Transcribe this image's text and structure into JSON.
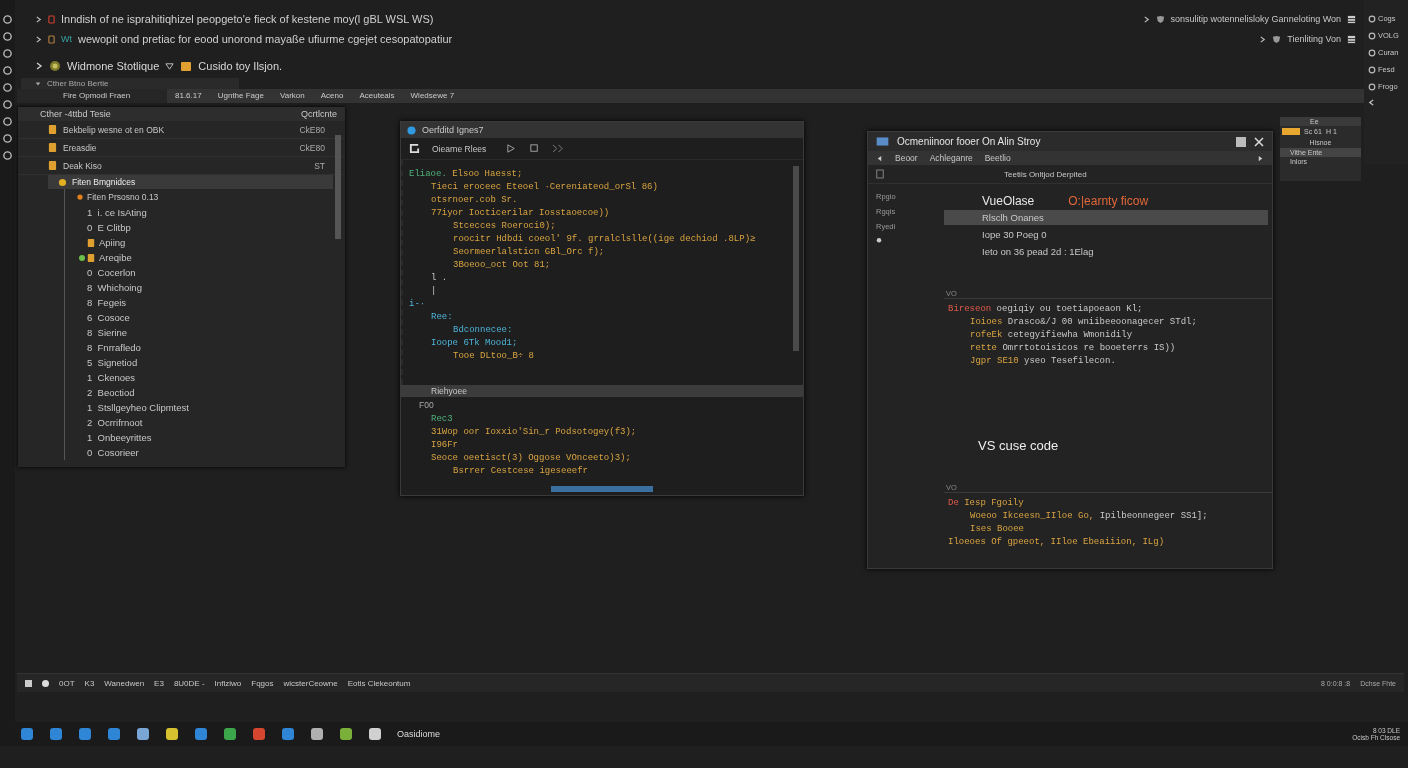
{
  "top_lines": [
    {
      "text": "Inndish of ne isprahitiqhizel peopgeto'e fieck of kestene moy(l gBL WSL WS)",
      "right": "sonsulitip wotennelisloky Ganneloting Won"
    },
    {
      "text": "wewopit ond pretiac for eood unorond mayaße ufiurme cgejet cesopatopatiur",
      "tag": "Wt",
      "right": "Tienliting Von"
    }
  ],
  "breadcrumb": [
    "Widmone Stotlique",
    "Cusido toy Ilsjon."
  ],
  "panel_header": "Cther Btno Bertie",
  "tabs": [
    {
      "label": "Fire Opmodi Fraen",
      "selected": true
    },
    {
      "label": "81.6.17",
      "selected": false
    },
    {
      "label": "Ugnthe Fage",
      "selected": false
    },
    {
      "label": "Varkon",
      "selected": false
    },
    {
      "label": "Aceno",
      "selected": false
    },
    {
      "label": "Aceuteals",
      "selected": false
    },
    {
      "label": "Wiedsewe 7",
      "selected": false
    }
  ],
  "explorer": {
    "title": "Cther -4ttbd Tesie",
    "action": "Qcrtlcnte",
    "rows": [
      {
        "name": "Bekbelip wesne ot en OBK",
        "meta": "CkE80"
      },
      {
        "name": "Ereasdie",
        "meta": "CkE80"
      },
      {
        "name": "Deak Kiso",
        "meta": "ST"
      }
    ],
    "selected_item": "Fiten Bmgnidces",
    "group": "Fiten Prsosno 0.13",
    "items": [
      {
        "kind": "count",
        "count": "1",
        "label": "i. ce IsAting"
      },
      {
        "kind": "count",
        "count": "0",
        "label": "E Clitbp"
      },
      {
        "kind": "file",
        "label": "Apiing"
      },
      {
        "kind": "file",
        "label": "Areqibe",
        "color": "#6cc04a"
      },
      {
        "kind": "count",
        "count": "0",
        "label": "Cocerlon"
      },
      {
        "kind": "count",
        "count": "8",
        "label": "Whichoing"
      },
      {
        "kind": "count",
        "count": "8",
        "label": "Fegeis"
      },
      {
        "kind": "count",
        "count": "6",
        "label": "Cosoce"
      },
      {
        "kind": "count",
        "count": "8",
        "label": "Sierine"
      },
      {
        "kind": "count",
        "count": "8",
        "label": "Fnrrafledo"
      },
      {
        "kind": "count",
        "count": "5",
        "label": "Signetiod"
      },
      {
        "kind": "count",
        "count": "1",
        "label": "Ckenoes"
      },
      {
        "kind": "count",
        "count": "2",
        "label": "Beoctiod"
      },
      {
        "kind": "count",
        "count": "1",
        "label": "Stsllgeyheo Clipmtest"
      },
      {
        "kind": "count",
        "count": "2",
        "label": "Ocrrifrnoot"
      },
      {
        "kind": "count",
        "count": "1",
        "label": "Onbeeyrittes"
      },
      {
        "kind": "count",
        "count": "0",
        "label": "Cosorieer"
      }
    ]
  },
  "editor": {
    "title": "Oerfditd Ignes7",
    "toolbar_label": "Oiearne Rlees",
    "lines": [
      {
        "parts": [
          {
            "kind": "keyword",
            "text": "Eliaoe."
          },
          {
            "kind": "string",
            "text": " Elsoo Haesst;"
          }
        ],
        "children": [
          {
            "parts": [
              {
                "kind": "string",
                "text": "Tieci eroceec Eteoel ·Cereniateod_orSl 86)"
              }
            ]
          },
          {
            "parts": [
              {
                "kind": "string",
                "text": "otsrnoer.cob Sr."
              }
            ]
          },
          {
            "parts": [
              {
                "kind": "string",
                "text": "77iyor Iocticerilar Iosstaoecoe))"
              }
            ],
            "children": [
              {
                "parts": [
                  {
                    "kind": "string",
                    "text": "Stcecces Roeroci0);"
                  }
                ]
              },
              {
                "parts": [
                  {
                    "kind": "string",
                    "text": "roocitr Hdbdi coeol' 9f. grralclslle((ige dechiod .8LP)≥"
                  }
                ]
              },
              {
                "parts": [
                  {
                    "kind": "string",
                    "text": "Seormeerlalsticn GBl_Orc f);"
                  }
                ]
              },
              {
                "parts": [
                  {
                    "kind": "string",
                    "text": "3Boeoo_oct Oot 81;"
                  }
                ]
              }
            ]
          },
          {
            "parts": [
              {
                "kind": "plain",
                "text": "l ."
              }
            ]
          },
          {
            "parts": [
              {
                "kind": "plain",
                "text": "|"
              }
            ]
          }
        ]
      },
      {
        "parts": [
          {
            "kind": "type",
            "text": "i-·"
          }
        ],
        "children": [
          {
            "parts": [
              {
                "kind": "type",
                "text": "Ree:"
              }
            ],
            "children": [
              {
                "parts": [
                  {
                    "kind": "type",
                    "text": "Bdconnecee:"
                  }
                ]
              }
            ]
          },
          {
            "parts": [
              {
                "kind": "type",
                "text": "Ioope 6Tk Mood1;"
              }
            ],
            "children": [
              {
                "parts": [
                  {
                    "kind": "string",
                    "text": "Tooe DLtoo_B÷ 8"
                  }
                ]
              }
            ]
          }
        ]
      }
    ],
    "panel_label": "Riehyoee",
    "panel_header": "F00",
    "panel_lines": [
      {
        "parts": [
          {
            "kind": "keyword",
            "text": "Rec3"
          }
        ]
      },
      {
        "parts": [
          {
            "kind": "string",
            "text": "31Wop oor Ioxxio'Sin_r Podsotogey(f3);"
          }
        ]
      },
      {
        "parts": [
          {
            "kind": "string",
            "text": "I96Fr"
          }
        ]
      },
      {
        "parts": [
          {
            "kind": "string",
            "text": "Seoce oeetisct(3) Oggose VOnceeto)3);"
          }
        ],
        "children": [
          {
            "parts": [
              {
                "kind": "string",
                "text": "Bsrrer Cestcese igeseeefr"
              }
            ]
          }
        ]
      }
    ]
  },
  "viewer": {
    "title": "Ocmeniinoor fooer On Alin Stroy",
    "nav": [
      "Beoor",
      "Achleganre",
      "Beetlio"
    ],
    "subtitle": "Teetiis Onltjod Derpited",
    "side_items": [
      "Rpgio",
      "Rgqis",
      "Ryedi"
    ],
    "heading": "VueOlase",
    "heading_note": "O:|earnty ficow",
    "rows": [
      {
        "text": "Rlsclh Onanes",
        "selected": true
      },
      {
        "text": "Iope 30 Poeg 0",
        "selected": false
      },
      {
        "text": "Ieto on 36 pead 2d : 1Elag",
        "selected": false
      }
    ],
    "sections": [
      {
        "label": "VO",
        "lines": [
          {
            "parts": [
              {
                "kind": "error",
                "text": "Bireseon"
              },
              {
                "kind": "plain",
                "text": " oegiqiy ou toetiapoeaon Kl;"
              }
            ],
            "children": [
              {
                "parts": [
                  {
                    "kind": "string",
                    "text": "Ioioes"
                  },
                  {
                    "kind": "plain",
                    "text": " Drasco&/J 00 wniibeeoonagecer STdl;"
                  }
                ]
              },
              {
                "parts": [
                  {
                    "kind": "string",
                    "text": "rofeEk"
                  },
                  {
                    "kind": "plain",
                    "text": " cetegyifiewha Wmonidily"
                  }
                ]
              },
              {
                "parts": [
                  {
                    "kind": "string",
                    "text": "rette"
                  },
                  {
                    "kind": "plain",
                    "text": " Omrrtotoisicos re booeterrs IS))"
                  }
                ]
              },
              {
                "parts": [
                  {
                    "kind": "string",
                    "text": "Jgpr SE10"
                  },
                  {
                    "kind": "plain",
                    "text": " yseo Tesefilecon."
                  }
                ]
              }
            ]
          }
        ]
      },
      {
        "label": "VO",
        "lines": [
          {
            "parts": [
              {
                "kind": "error",
                "text": "De"
              },
              {
                "kind": "string",
                "text": " Iesp Fgoily"
              }
            ],
            "children": [
              {
                "parts": [
                  {
                    "kind": "string",
                    "text": "Woeoo Ikceesn_IIloe Go,"
                  },
                  {
                    "kind": "plain",
                    "text": " Ipilbeonnegeer SS1];"
                  }
                ]
              },
              {
                "parts": [
                  {
                    "kind": "string",
                    "text": "Ises Booee"
                  }
                ]
              }
            ]
          },
          {
            "parts": [
              {
                "kind": "string",
                "text": "Iloeoes Of gpeeot, IIloe Ebeaiiion, ILg)"
              }
            ]
          }
        ]
      }
    ],
    "big_text": "VS cuse code"
  },
  "mini_panel": {
    "header": "Ee",
    "value": "Sc 61",
    "extra": "H 1",
    "label": "Hisnoe",
    "items": [
      {
        "text": "Vithe Ente",
        "selected": true
      },
      {
        "text": "Inlors",
        "selected": false
      }
    ]
  },
  "right_sidebar": [
    "Cogs",
    "VOLG",
    "Curan",
    "Fesd",
    "Frogo"
  ],
  "status_bar": {
    "items": [
      "0OT",
      "K3",
      "Wanedwen",
      "E3",
      "8U0DE -",
      "Infiziwo",
      "Fqgos",
      "wicsterCeowne",
      "Eotis Clekeontum"
    ],
    "right": [
      "8 0:0:8 :8",
      "Dchse Fhte"
    ]
  },
  "taskbar": {
    "label": "Oasidiome",
    "clock": [
      "8 03 DLE",
      "Ocisb Fh Clsose"
    ]
  }
}
